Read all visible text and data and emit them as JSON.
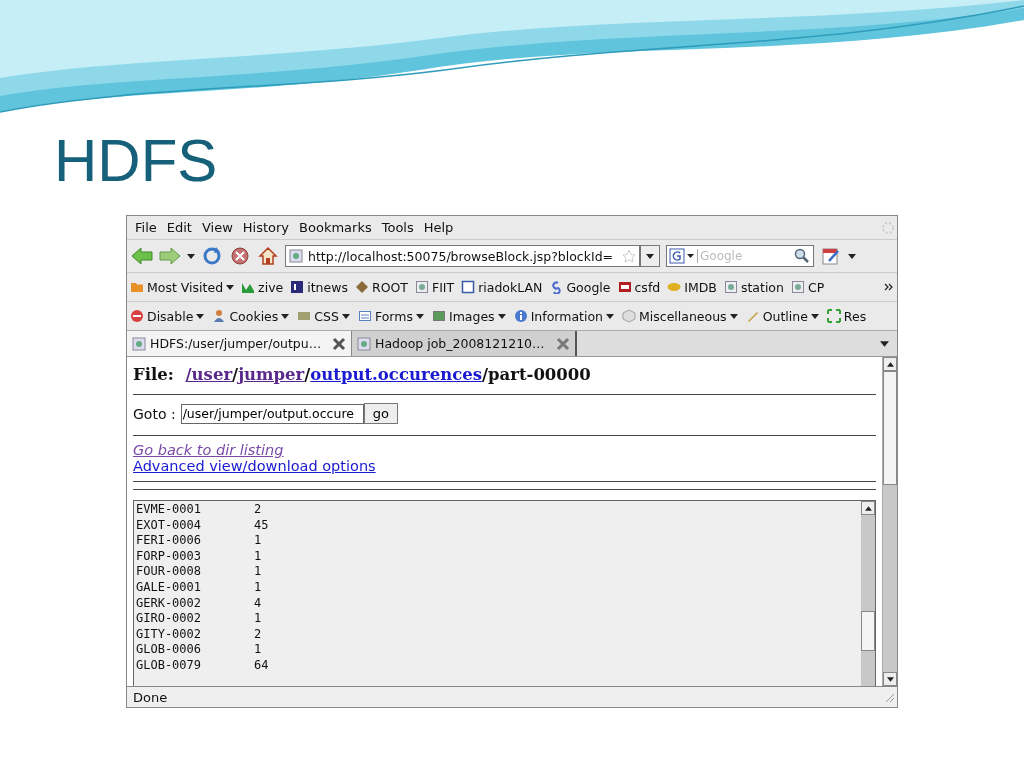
{
  "slide": {
    "title": "HDFS"
  },
  "browser": {
    "menu": [
      {
        "label": "File"
      },
      {
        "label": "Edit"
      },
      {
        "label": "View"
      },
      {
        "label": "History"
      },
      {
        "label": "Bookmarks"
      },
      {
        "label": "Tools"
      },
      {
        "label": "Help"
      }
    ],
    "address": {
      "value": "http://localhost:50075/browseBlock.jsp?blockId="
    },
    "search": {
      "placeholder": "Google"
    },
    "bookmarks": [
      {
        "label": "Most Visited",
        "kind": "folder",
        "dropdown": true
      },
      {
        "label": "zive",
        "kind": "chart",
        "dropdown": false
      },
      {
        "label": "itnews",
        "kind": "square",
        "dropdown": false
      },
      {
        "label": "ROOT",
        "kind": "diamond",
        "dropdown": false
      },
      {
        "label": "FIIT",
        "kind": "page",
        "dropdown": false
      },
      {
        "label": "riadokLAN",
        "kind": "frame",
        "dropdown": false
      },
      {
        "label": "Google",
        "kind": "swirl",
        "dropdown": false
      },
      {
        "label": "csfd",
        "kind": "film",
        "dropdown": false
      },
      {
        "label": "IMDB",
        "kind": "badge",
        "dropdown": false
      },
      {
        "label": "station",
        "kind": "page",
        "dropdown": false
      },
      {
        "label": "CP",
        "kind": "page",
        "dropdown": false
      }
    ],
    "tools": [
      {
        "label": "Disable",
        "kind": "stop",
        "dropdown": true
      },
      {
        "label": "Cookies",
        "kind": "person",
        "dropdown": true
      },
      {
        "label": "CSS",
        "kind": "card",
        "dropdown": true
      },
      {
        "label": "Forms",
        "kind": "form",
        "dropdown": true
      },
      {
        "label": "Images",
        "kind": "image",
        "dropdown": true
      },
      {
        "label": "Information",
        "kind": "info",
        "dropdown": true
      },
      {
        "label": "Miscellaneous",
        "kind": "cube",
        "dropdown": true
      },
      {
        "label": "Outline",
        "kind": "pen",
        "dropdown": true
      },
      {
        "label": "Res",
        "kind": "arrows",
        "dropdown": false
      }
    ],
    "tabs": [
      {
        "label": "HDFS:/user/jumper/outpu…",
        "selected": true
      },
      {
        "label": "Hadoop job_2008121210…",
        "selected": false
      }
    ],
    "page": {
      "heading": {
        "label": "File:",
        "segments": [
          {
            "text": "/user",
            "kind": "link",
            "visited": true
          },
          {
            "text": "/",
            "kind": "text"
          },
          {
            "text": "jumper",
            "kind": "link",
            "visited": true
          },
          {
            "text": "/",
            "kind": "text"
          },
          {
            "text": "output.occurences",
            "kind": "link",
            "visited": false
          },
          {
            "text": "/part-00000",
            "kind": "text"
          }
        ]
      },
      "goto": {
        "label": "Goto :",
        "value": "/user/jumper/output.occure",
        "button": "go"
      },
      "links": [
        {
          "text": "Go back to dir listing",
          "visited": true
        },
        {
          "text": "Advanced view/download options",
          "visited": false
        }
      ],
      "file_rows": [
        {
          "key": "EVME-0001",
          "count": "2"
        },
        {
          "key": "EXOT-0004",
          "count": "45"
        },
        {
          "key": "FERI-0006",
          "count": "1"
        },
        {
          "key": "FORP-0003",
          "count": "1"
        },
        {
          "key": "FOUR-0008",
          "count": "1"
        },
        {
          "key": "GALE-0001",
          "count": "1"
        },
        {
          "key": "GERK-0002",
          "count": "4"
        },
        {
          "key": "GIRO-0002",
          "count": "1"
        },
        {
          "key": "GITY-0002",
          "count": "2"
        },
        {
          "key": "GLOB-0006",
          "count": "1"
        },
        {
          "key": "GLOB-0079",
          "count": "64"
        }
      ]
    },
    "status_bar": "Done"
  }
}
